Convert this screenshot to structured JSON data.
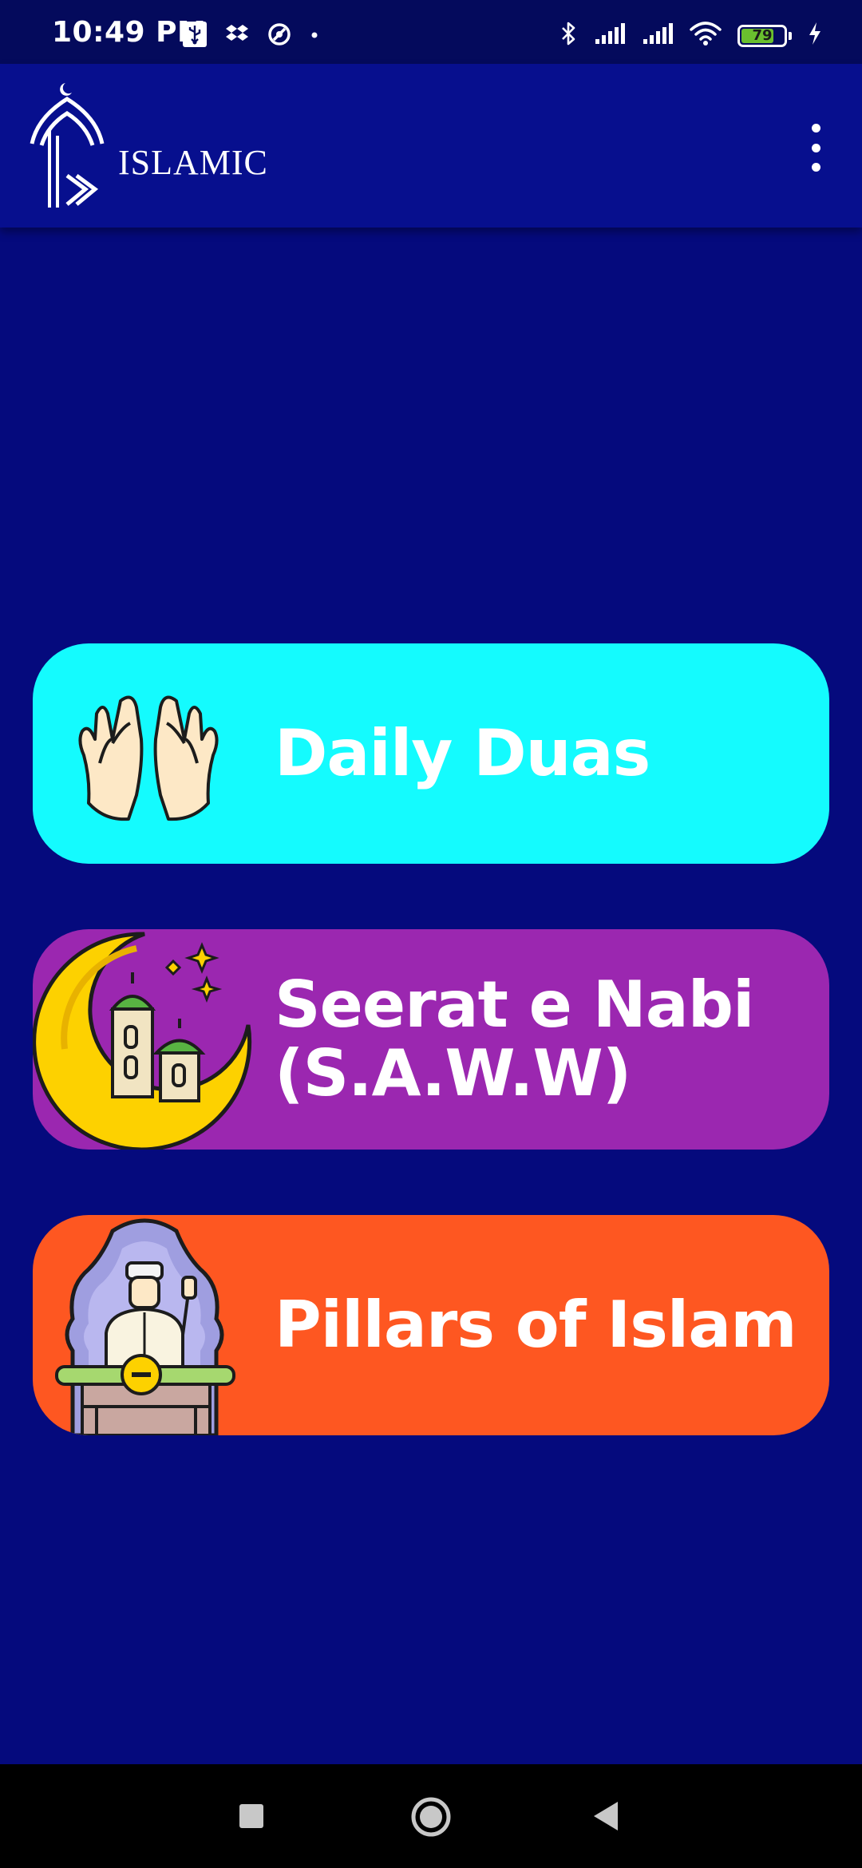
{
  "status_bar": {
    "time": "10:49 PM",
    "left_icons": [
      "usb-icon",
      "dropbox-icon",
      "data-saver-icon",
      "notification-dot-icon"
    ],
    "right_icons": [
      "bluetooth-icon",
      "signal-icon",
      "signal-icon",
      "wifi-icon"
    ],
    "battery_level": "79",
    "battery_fraction": 0.79,
    "charging": true
  },
  "app_bar": {
    "title": "ISLAMIC",
    "logo_icon": "mosque-logo-icon",
    "menu_icon": "more-vert-icon"
  },
  "menu": [
    {
      "label": "Daily Duas",
      "icon": "praying-hands-icon",
      "color": "#14fbfe"
    },
    {
      "label": "Seerat e Nabi (S.A.W.W)",
      "icon": "crescent-mosque-icon",
      "color": "#9b27b0"
    },
    {
      "label": "Pillars of Islam",
      "icon": "imam-minbar-icon",
      "color": "#fe5721"
    }
  ],
  "nav_bar": {
    "buttons": [
      "recents-icon",
      "home-icon",
      "back-icon"
    ]
  },
  "colors": {
    "background": "#050a7d",
    "app_bar": "#070f8e",
    "status_bar": "#040a5c"
  }
}
